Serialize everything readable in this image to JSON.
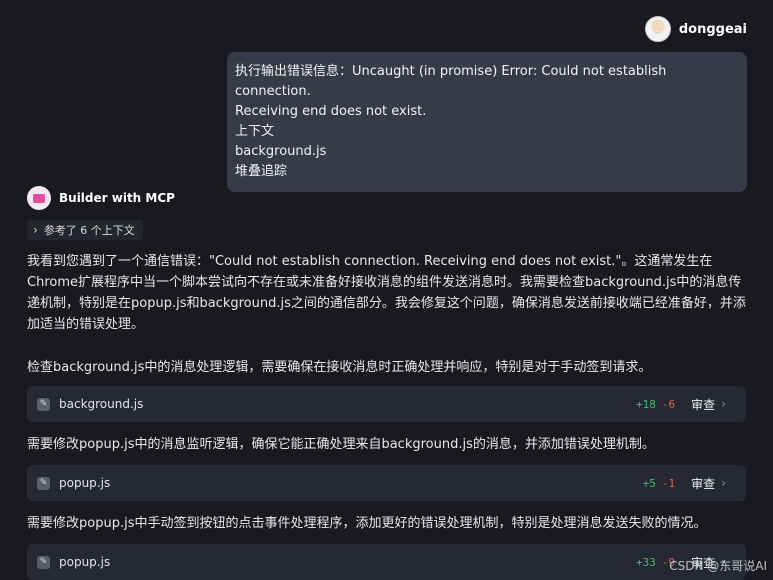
{
  "user": {
    "name": "donggeai"
  },
  "user_message": {
    "lines": [
      "执行输出错误信息：Uncaught (in promise) Error: Could not establish connection.",
      "Receiving end does not exist.",
      "上下文",
      "background.js",
      "堆叠追踪"
    ]
  },
  "assistant": {
    "name": "Builder with MCP",
    "context_label": "参考了 6 个上下文",
    "intro": "我看到您遇到了一个通信错误：\"Could not establish connection. Receiving end does not exist.\"。这通常发生在Chrome扩展程序中当一个脚本尝试向不存在或未准备好接收消息的组件发送消息时。我需要检查background.js中的消息传递机制，特别是在popup.js和background.js之间的通信部分。我会修复这个问题，确保消息发送前接收端已经准备好，并添加适当的错误处理。",
    "steps": [
      {
        "text": "检查background.js中的消息处理逻辑，需要确保在接收消息时正确处理并响应，特别是对于手动签到请求。",
        "file": "background.js",
        "added": "+18",
        "removed": "-6",
        "review": "审查"
      },
      {
        "text": "需要修改popup.js中的消息监听逻辑，确保它能正确处理来自background.js的消息，并添加错误处理机制。",
        "file": "popup.js",
        "added": "+5",
        "removed": "-1",
        "review": "审查"
      },
      {
        "text": "需要修改popup.js中手动签到按钮的点击事件处理程序，添加更好的错误处理机制，特别是处理消息发送失败的情况。",
        "file": "popup.js",
        "added": "+33",
        "removed": "-9",
        "review": "审查"
      }
    ]
  },
  "watermark": "CSDN @东哥说AI"
}
